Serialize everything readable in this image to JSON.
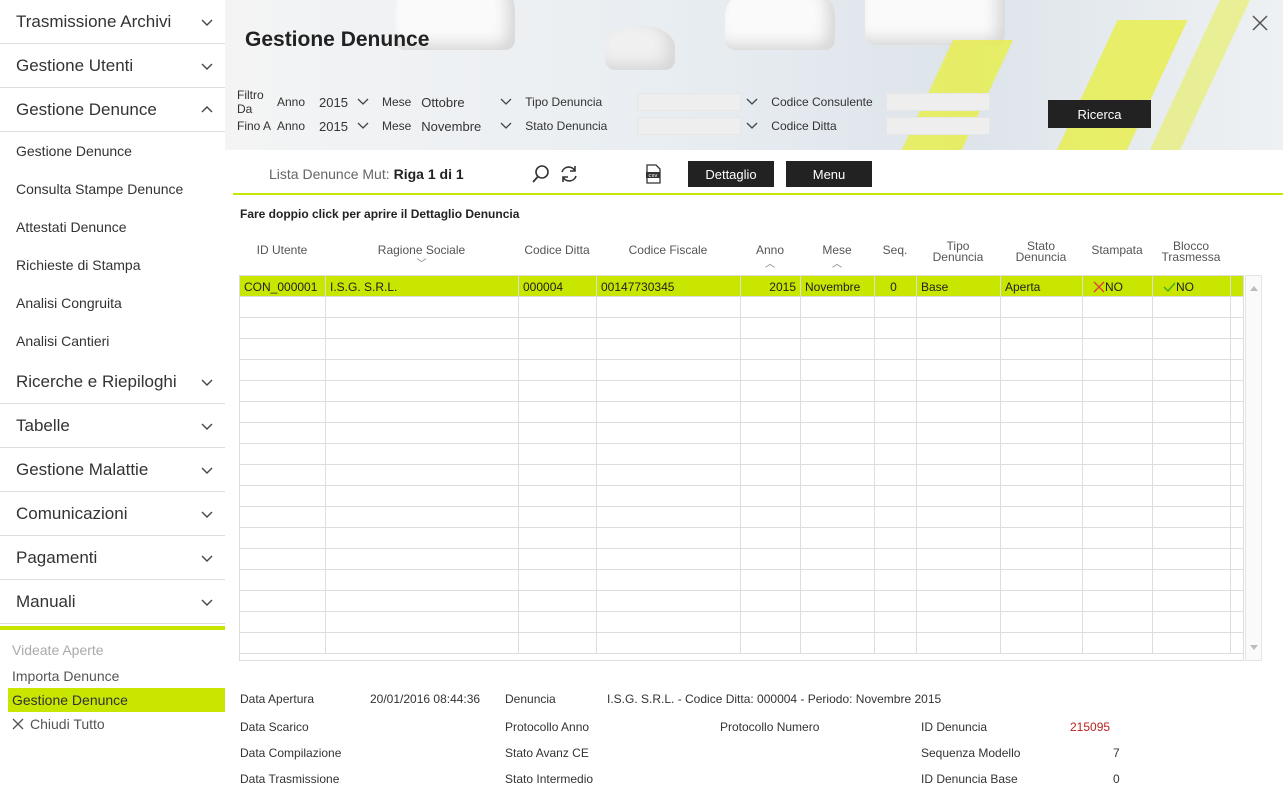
{
  "sidebar": {
    "menus": [
      {
        "label": "Trasmissione Archivi",
        "expanded": false
      },
      {
        "label": "Gestione Utenti",
        "expanded": false
      },
      {
        "label": "Gestione Denunce",
        "expanded": true,
        "items": [
          "Gestione Denunce",
          "Consulta Stampe Denunce",
          "Attestati Denunce",
          "Richieste di Stampa",
          "Analisi Congruita",
          "Analisi Cantieri"
        ]
      },
      {
        "label": "Ricerche e Riepiloghi",
        "expanded": false
      },
      {
        "label": "Tabelle",
        "expanded": false
      },
      {
        "label": "Gestione Malattie",
        "expanded": false
      },
      {
        "label": "Comunicazioni",
        "expanded": false
      },
      {
        "label": "Pagamenti",
        "expanded": false
      },
      {
        "label": "Manuali",
        "expanded": false
      }
    ],
    "videate": {
      "title": "Videate Aperte",
      "items": [
        "Importa Denunce",
        "Gestione Denunce"
      ],
      "active_index": 1,
      "close_all": "Chiudi Tutto"
    }
  },
  "header": {
    "title": "Gestione Denunce"
  },
  "filters": {
    "da_label": "Filtro Da",
    "a_label": "Fino A",
    "anno_label": "Anno",
    "mese_label": "Mese",
    "anno_da": "2015",
    "mese_da": "Ottobre",
    "anno_a": "2015",
    "mese_a": "Novembre",
    "tipo_label": "Tipo Denuncia",
    "tipo_value": "",
    "stato_label": "Stato Denuncia",
    "stato_value": "",
    "consulente_label": "Codice Consulente",
    "consulente_value": "",
    "ditta_label": "Codice Ditta",
    "ditta_value": "",
    "search_button": "Ricerca"
  },
  "toolbar": {
    "lista_label": "Lista Denunce Mut:",
    "riga": "Riga 1 di 1",
    "dettaglio_button": "Dettaglio",
    "menu_button": "Menu",
    "csv_text": "csv"
  },
  "grid": {
    "hint": "Fare doppio click per aprire il Dettaglio Denuncia",
    "columns": [
      {
        "l1": "",
        "l2": "ID Utente",
        "sort": ""
      },
      {
        "l1": "",
        "l2": "Ragione Sociale",
        "sort": "﹀"
      },
      {
        "l1": "",
        "l2": "Codice Ditta",
        "sort": ""
      },
      {
        "l1": "",
        "l2": "Codice Fiscale",
        "sort": ""
      },
      {
        "l1": "",
        "l2": "Anno",
        "sort": "︿"
      },
      {
        "l1": "",
        "l2": "Mese",
        "sort": "︿"
      },
      {
        "l1": "",
        "l2": "Seq.",
        "sort": ""
      },
      {
        "l1": "Tipo",
        "l2": "Denuncia",
        "sort": ""
      },
      {
        "l1": "Stato",
        "l2": "Denuncia",
        "sort": ""
      },
      {
        "l1": "",
        "l2": "Stampata",
        "sort": ""
      },
      {
        "l1": "Blocco",
        "l2": "Trasmessa",
        "sort": ""
      }
    ],
    "rows": [
      [
        "CON_000001",
        "I.S.G. S.R.L.",
        "000004",
        "00147730345",
        "2015",
        "Novembre",
        "0",
        "Base",
        "Aperta",
        "NO",
        "NO"
      ]
    ],
    "empty_rows": 17
  },
  "details": {
    "data_apertura_label": "Data Apertura",
    "data_apertura": "20/01/2016 08:44:36",
    "denuncia_label": "Denuncia",
    "denuncia": "I.S.G. S.R.L. - Codice Ditta: 000004 - Periodo: Novembre 2015",
    "data_scarico_label": "Data Scarico",
    "protocollo_anno_label": "Protocollo Anno",
    "protocollo_numero_label": "Protocollo Numero",
    "id_denuncia_label": "ID Denuncia",
    "id_denuncia": "215095",
    "data_compilazione_label": "Data Compilazione",
    "stato_avanz_label": "Stato Avanz CE",
    "sequenza_label": "Sequenza Modello",
    "sequenza": "7",
    "data_trasmissione_label": "Data Trasmissione",
    "stato_intermedio_label": "Stato Intermedio",
    "id_base_label": "ID Denuncia Base",
    "id_base": "0"
  },
  "colors": {
    "accent": "#c8e600",
    "dark_button": "#222222",
    "id_value": "#bb2222",
    "no_red": "#dd4444",
    "check_green": "#44aa22"
  }
}
